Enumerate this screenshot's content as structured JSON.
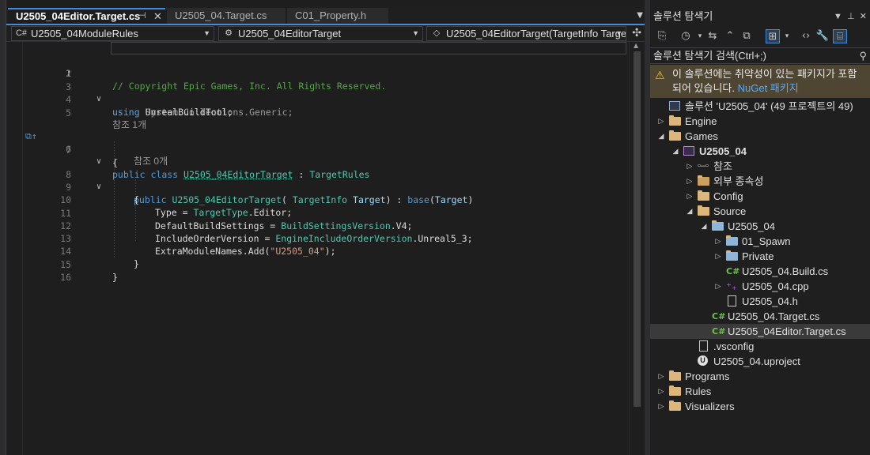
{
  "tabs": [
    {
      "label": "U2505_04Editor.Target.cs",
      "active": true,
      "pinned": true
    },
    {
      "label": "U2505_04.Target.cs",
      "active": false
    },
    {
      "label": "C01_Property.h",
      "active": false
    }
  ],
  "navbar": {
    "project": "U2505_04ModuleRules",
    "type": "U2505_04EditorTarget",
    "member": "U2505_04EditorTarget(TargetInfo Target)"
  },
  "editor": {
    "current_line": 1,
    "line_numbers": [
      "1",
      "2",
      "3",
      "4",
      "5",
      "6",
      "7",
      "8",
      "9",
      "10",
      "11",
      "12",
      "13",
      "14",
      "15",
      "16"
    ],
    "hints": {
      "refs_class": "참조 1개",
      "refs_ctor": "참조 0개"
    },
    "code": {
      "l1_comment": "// Copyright Epic Games, Inc. All Rights Reserved.",
      "kw_using": "using",
      "l3_ns": "UnrealBuildTool;",
      "l4_ns": "System.Collections.Generic;",
      "kw_public": "public",
      "kw_class": "class",
      "class_name": "U2505_04EditorTarget",
      "colon": " : ",
      "base_type": "TargetRules",
      "open_brace": "{",
      "close_brace": "}",
      "ctor_name": "U2505_04EditorTarget",
      "ctor_open": "( ",
      "param_type": "TargetInfo",
      "param_name": "Target",
      "ctor_close": ") : ",
      "kw_base": "base",
      "base_open": "(",
      "base_arg": "Target",
      "base_close": ")",
      "l10_prop": "Type",
      "eq": " = ",
      "l10_type": "TargetType",
      "l10_val": ".Editor;",
      "l11_prop": "DefaultBuildSettings",
      "l11_type": "BuildSettingsVersion",
      "l11_val": ".V4;",
      "l12_prop": "IncludeOrderVersion",
      "l12_type": "EngineIncludeOrderVersion",
      "l12_val": ".Unreal5_3;",
      "l13_call": "ExtraModuleNames.Add(",
      "l13_str": "\"U2505_04\"",
      "l13_end": ");"
    }
  },
  "solution_explorer": {
    "title": "솔루션 탐색기",
    "search_placeholder": "솔루션 탐색기 검색(Ctrl+;)",
    "warning_text": "이 솔루션에는 취약성이 있는 패키지가 포함되어 있습니다.",
    "warning_link": "NuGet 패키지",
    "tree": [
      {
        "label": "솔루션 'U2505_04'",
        "suffix": "(49 프로젝트의 49)",
        "depth": 0,
        "icon": "solution-icon",
        "expand": "none"
      },
      {
        "label": "Engine",
        "depth": 0,
        "icon": "folder-icon",
        "expand": "collapsed"
      },
      {
        "label": "Games",
        "depth": 0,
        "icon": "folder-icon",
        "expand": "expanded"
      },
      {
        "label": "U2505_04",
        "depth": 1,
        "icon": "project-icon",
        "expand": "expanded",
        "bold": true
      },
      {
        "label": "참조",
        "depth": 2,
        "icon": "references-icon",
        "expand": "collapsed"
      },
      {
        "label": "외부 종속성",
        "depth": 2,
        "icon": "external-deps-icon",
        "expand": "collapsed"
      },
      {
        "label": "Config",
        "depth": 2,
        "icon": "folder-icon",
        "expand": "collapsed"
      },
      {
        "label": "Source",
        "depth": 2,
        "icon": "folder-icon",
        "expand": "expanded"
      },
      {
        "label": "U2505_04",
        "depth": 3,
        "icon": "filter-folder-icon",
        "expand": "expanded"
      },
      {
        "label": "01_Spawn",
        "depth": 4,
        "icon": "filter-folder-icon",
        "expand": "collapsed"
      },
      {
        "label": "Private",
        "depth": 4,
        "icon": "filter-folder-icon",
        "expand": "collapsed"
      },
      {
        "label": "U2505_04.Build.cs",
        "depth": 4,
        "icon": "csharp-file-icon",
        "expand": "none"
      },
      {
        "label": "U2505_04.cpp",
        "depth": 4,
        "icon": "cpp-file-icon",
        "expand": "collapsed"
      },
      {
        "label": "U2505_04.h",
        "depth": 4,
        "icon": "header-file-icon",
        "expand": "none"
      },
      {
        "label": "U2505_04.Target.cs",
        "depth": 3,
        "icon": "csharp-file-icon",
        "expand": "none"
      },
      {
        "label": "U2505_04Editor.Target.cs",
        "depth": 3,
        "icon": "csharp-file-icon",
        "expand": "none",
        "selected": true
      },
      {
        "label": ".vsconfig",
        "depth": 2,
        "icon": "file-icon",
        "expand": "none"
      },
      {
        "label": "U2505_04.uproject",
        "depth": 2,
        "icon": "unreal-project-icon",
        "expand": "none"
      },
      {
        "label": "Programs",
        "depth": 0,
        "icon": "folder-icon",
        "expand": "collapsed"
      },
      {
        "label": "Rules",
        "depth": 0,
        "icon": "folder-icon",
        "expand": "collapsed"
      },
      {
        "label": "Visualizers",
        "depth": 0,
        "icon": "folder-icon",
        "expand": "collapsed"
      }
    ]
  },
  "colors": {
    "accent": "#3d8ee0",
    "keyword": "#569cd6",
    "type": "#4ec9b0",
    "string": "#d69d85",
    "comment": "#57a64a",
    "warning_bg": "#4e4632"
  }
}
